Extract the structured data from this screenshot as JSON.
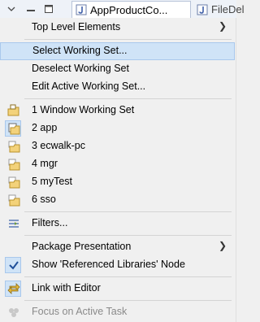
{
  "toolbar": {
    "tabs": [
      {
        "label": "AppProductCo...",
        "active": true
      },
      {
        "label": "FileDel",
        "active": false
      }
    ]
  },
  "menu": {
    "items": [
      {
        "label": "Top Level Elements",
        "submenu": true
      },
      {
        "label": "Select Working Set...",
        "highlighted": true
      },
      {
        "label": "Deselect Working Set"
      },
      {
        "label": "Edit Active Working Set..."
      },
      {
        "label": "1 Window Working Set",
        "icon": "window-working-set-icon"
      },
      {
        "label": "2 app",
        "icon": "working-set-icon",
        "checked": true
      },
      {
        "label": "3 ecwalk-pc",
        "icon": "working-set-icon"
      },
      {
        "label": "4 mgr",
        "icon": "working-set-icon"
      },
      {
        "label": "5 myTest",
        "icon": "working-set-icon"
      },
      {
        "label": "6 sso",
        "icon": "working-set-icon"
      },
      {
        "label": "Filters...",
        "icon": "filter-icon"
      },
      {
        "label": "Package Presentation",
        "submenu": true
      },
      {
        "label": "Show 'Referenced Libraries' Node",
        "checked": true
      },
      {
        "label": "Link with Editor",
        "icon": "link-editor-icon",
        "checked": true
      },
      {
        "label": "Focus on Active Task",
        "icon": "focus-task-icon",
        "disabled": true
      }
    ]
  },
  "colors": {
    "menu_bg": "#f0f0f0",
    "highlight": "#cfe3f7",
    "highlight_border": "#a9c8ec",
    "disabled_text": "#8a8a8a"
  }
}
